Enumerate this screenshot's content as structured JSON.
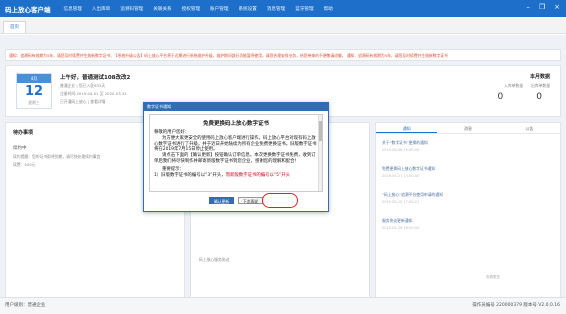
{
  "app": {
    "title": "码上放心客户端",
    "menu": [
      "信息管理",
      "入出库单",
      "追溯码管理",
      "关联关系",
      "授权管理",
      "账户管理",
      "系统设置",
      "消息管理",
      "蓝牙管理",
      "帮助"
    ],
    "window_controls": [
      "–",
      "❐",
      "×"
    ]
  },
  "tabs": [
    {
      "label": "首页"
    }
  ],
  "ticker": {
    "text": "通知：追溯码有效期为5年，请您及时续费并生效新数字证书；【系统升级公告】码上放心平台将于近期进行系统维护升级，维护期间部分功能暂停使用，请您合理安排业务，给您带来的不便敬请谅解。    通知：追溯码有效期为5年，请您及时续费并生效新数字证书"
  },
  "welcome": {
    "month": "4月",
    "day": "12",
    "weekday": "星期三",
    "greeting": "上午好，普通测试108改改2",
    "line1": "普通企业 | 您已入驻633天",
    "line2": "注册时间:2019-04-01 至 2020-03-31",
    "line3_prefix": "已开通码上放心 | 查看详情",
    "line3_link": "查看详情"
  },
  "stats": {
    "title": "本月数据",
    "labels": [
      "入库单数量",
      "出库单数量"
    ],
    "values": [
      "0",
      "0"
    ]
  },
  "todo": {
    "title": "待办事项",
    "item": "续约中",
    "line1": "续约提醒：您的证书即将到期，请尽快处理续约事宜",
    "line2": "续费：500元"
  },
  "middle": {
    "items": [
      "码上放心服务协议",
      "码上放心服务协议"
    ]
  },
  "right_tabs": [
    {
      "label": "通知",
      "active": true
    },
    {
      "label": "消息",
      "active": false
    },
    {
      "label": "公告",
      "active": false
    }
  ],
  "notices": [
    {
      "title": "关于“数字证书”更换的通知",
      "date": "2019-06-06 15:00:00"
    },
    {
      "title": "免费更换码上放心数字证书通知",
      "date": "2019-05-21 13:00:00"
    },
    {
      "title": "“码上放心”追溯平台使用申请的通知",
      "date": "2019-05-10 17:05:21"
    },
    {
      "title": "服务协议更新通知",
      "date": "2019-04-26 16:00:00"
    }
  ],
  "more_label": "查看更多",
  "statusbar": {
    "left": "用户级别：普通企业",
    "right": "操作员编号 220000379  版本号 V2.0.0.16"
  },
  "dialog": {
    "title": "数字证书通知",
    "heading": "免费更换码上放心数字证书",
    "salutation": "尊敬的用户您好：",
    "para1": "为方便大家更安全的使用码上放心客户端进行操作，码上放心平台对现有码上放心数字证书进行了升级，并于近日开始陆续为所有企业免费更换证书。旧版数字证书将在2019年7月15日停止使用。",
    "para2": "请点击下面的【确认更新】按钮确认订单信息。本次更换数字证书免费，收到订单后我们将尽快制作并邮寄新版数字证书到您企业，感谢您的理解和配合！",
    "tips_title": "重要提示：",
    "tip1_a": "1）旧版数字证书的编号以“3”开头，",
    "tip1_red": "而新版数字证书的编号以“5”开头",
    "buttons": {
      "confirm": "确认更新",
      "cancel": "下次再说"
    }
  }
}
